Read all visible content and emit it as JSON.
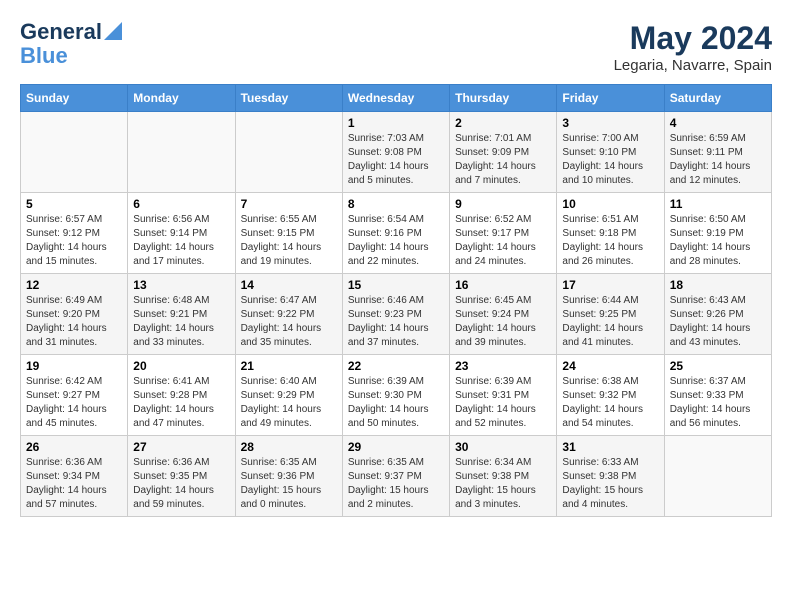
{
  "header": {
    "logo_line1": "General",
    "logo_line2": "Blue",
    "month_title": "May 2024",
    "location": "Legaria, Navarre, Spain"
  },
  "days_of_week": [
    "Sunday",
    "Monday",
    "Tuesday",
    "Wednesday",
    "Thursday",
    "Friday",
    "Saturday"
  ],
  "weeks": [
    [
      {
        "day": "",
        "sunrise": "",
        "sunset": "",
        "daylight": ""
      },
      {
        "day": "",
        "sunrise": "",
        "sunset": "",
        "daylight": ""
      },
      {
        "day": "",
        "sunrise": "",
        "sunset": "",
        "daylight": ""
      },
      {
        "day": "1",
        "sunrise": "Sunrise: 7:03 AM",
        "sunset": "Sunset: 9:08 PM",
        "daylight": "Daylight: 14 hours and 5 minutes."
      },
      {
        "day": "2",
        "sunrise": "Sunrise: 7:01 AM",
        "sunset": "Sunset: 9:09 PM",
        "daylight": "Daylight: 14 hours and 7 minutes."
      },
      {
        "day": "3",
        "sunrise": "Sunrise: 7:00 AM",
        "sunset": "Sunset: 9:10 PM",
        "daylight": "Daylight: 14 hours and 10 minutes."
      },
      {
        "day": "4",
        "sunrise": "Sunrise: 6:59 AM",
        "sunset": "Sunset: 9:11 PM",
        "daylight": "Daylight: 14 hours and 12 minutes."
      }
    ],
    [
      {
        "day": "5",
        "sunrise": "Sunrise: 6:57 AM",
        "sunset": "Sunset: 9:12 PM",
        "daylight": "Daylight: 14 hours and 15 minutes."
      },
      {
        "day": "6",
        "sunrise": "Sunrise: 6:56 AM",
        "sunset": "Sunset: 9:14 PM",
        "daylight": "Daylight: 14 hours and 17 minutes."
      },
      {
        "day": "7",
        "sunrise": "Sunrise: 6:55 AM",
        "sunset": "Sunset: 9:15 PM",
        "daylight": "Daylight: 14 hours and 19 minutes."
      },
      {
        "day": "8",
        "sunrise": "Sunrise: 6:54 AM",
        "sunset": "Sunset: 9:16 PM",
        "daylight": "Daylight: 14 hours and 22 minutes."
      },
      {
        "day": "9",
        "sunrise": "Sunrise: 6:52 AM",
        "sunset": "Sunset: 9:17 PM",
        "daylight": "Daylight: 14 hours and 24 minutes."
      },
      {
        "day": "10",
        "sunrise": "Sunrise: 6:51 AM",
        "sunset": "Sunset: 9:18 PM",
        "daylight": "Daylight: 14 hours and 26 minutes."
      },
      {
        "day": "11",
        "sunrise": "Sunrise: 6:50 AM",
        "sunset": "Sunset: 9:19 PM",
        "daylight": "Daylight: 14 hours and 28 minutes."
      }
    ],
    [
      {
        "day": "12",
        "sunrise": "Sunrise: 6:49 AM",
        "sunset": "Sunset: 9:20 PM",
        "daylight": "Daylight: 14 hours and 31 minutes."
      },
      {
        "day": "13",
        "sunrise": "Sunrise: 6:48 AM",
        "sunset": "Sunset: 9:21 PM",
        "daylight": "Daylight: 14 hours and 33 minutes."
      },
      {
        "day": "14",
        "sunrise": "Sunrise: 6:47 AM",
        "sunset": "Sunset: 9:22 PM",
        "daylight": "Daylight: 14 hours and 35 minutes."
      },
      {
        "day": "15",
        "sunrise": "Sunrise: 6:46 AM",
        "sunset": "Sunset: 9:23 PM",
        "daylight": "Daylight: 14 hours and 37 minutes."
      },
      {
        "day": "16",
        "sunrise": "Sunrise: 6:45 AM",
        "sunset": "Sunset: 9:24 PM",
        "daylight": "Daylight: 14 hours and 39 minutes."
      },
      {
        "day": "17",
        "sunrise": "Sunrise: 6:44 AM",
        "sunset": "Sunset: 9:25 PM",
        "daylight": "Daylight: 14 hours and 41 minutes."
      },
      {
        "day": "18",
        "sunrise": "Sunrise: 6:43 AM",
        "sunset": "Sunset: 9:26 PM",
        "daylight": "Daylight: 14 hours and 43 minutes."
      }
    ],
    [
      {
        "day": "19",
        "sunrise": "Sunrise: 6:42 AM",
        "sunset": "Sunset: 9:27 PM",
        "daylight": "Daylight: 14 hours and 45 minutes."
      },
      {
        "day": "20",
        "sunrise": "Sunrise: 6:41 AM",
        "sunset": "Sunset: 9:28 PM",
        "daylight": "Daylight: 14 hours and 47 minutes."
      },
      {
        "day": "21",
        "sunrise": "Sunrise: 6:40 AM",
        "sunset": "Sunset: 9:29 PM",
        "daylight": "Daylight: 14 hours and 49 minutes."
      },
      {
        "day": "22",
        "sunrise": "Sunrise: 6:39 AM",
        "sunset": "Sunset: 9:30 PM",
        "daylight": "Daylight: 14 hours and 50 minutes."
      },
      {
        "day": "23",
        "sunrise": "Sunrise: 6:39 AM",
        "sunset": "Sunset: 9:31 PM",
        "daylight": "Daylight: 14 hours and 52 minutes."
      },
      {
        "day": "24",
        "sunrise": "Sunrise: 6:38 AM",
        "sunset": "Sunset: 9:32 PM",
        "daylight": "Daylight: 14 hours and 54 minutes."
      },
      {
        "day": "25",
        "sunrise": "Sunrise: 6:37 AM",
        "sunset": "Sunset: 9:33 PM",
        "daylight": "Daylight: 14 hours and 56 minutes."
      }
    ],
    [
      {
        "day": "26",
        "sunrise": "Sunrise: 6:36 AM",
        "sunset": "Sunset: 9:34 PM",
        "daylight": "Daylight: 14 hours and 57 minutes."
      },
      {
        "day": "27",
        "sunrise": "Sunrise: 6:36 AM",
        "sunset": "Sunset: 9:35 PM",
        "daylight": "Daylight: 14 hours and 59 minutes."
      },
      {
        "day": "28",
        "sunrise": "Sunrise: 6:35 AM",
        "sunset": "Sunset: 9:36 PM",
        "daylight": "Daylight: 15 hours and 0 minutes."
      },
      {
        "day": "29",
        "sunrise": "Sunrise: 6:35 AM",
        "sunset": "Sunset: 9:37 PM",
        "daylight": "Daylight: 15 hours and 2 minutes."
      },
      {
        "day": "30",
        "sunrise": "Sunrise: 6:34 AM",
        "sunset": "Sunset: 9:38 PM",
        "daylight": "Daylight: 15 hours and 3 minutes."
      },
      {
        "day": "31",
        "sunrise": "Sunrise: 6:33 AM",
        "sunset": "Sunset: 9:38 PM",
        "daylight": "Daylight: 15 hours and 4 minutes."
      },
      {
        "day": "",
        "sunrise": "",
        "sunset": "",
        "daylight": ""
      }
    ]
  ]
}
